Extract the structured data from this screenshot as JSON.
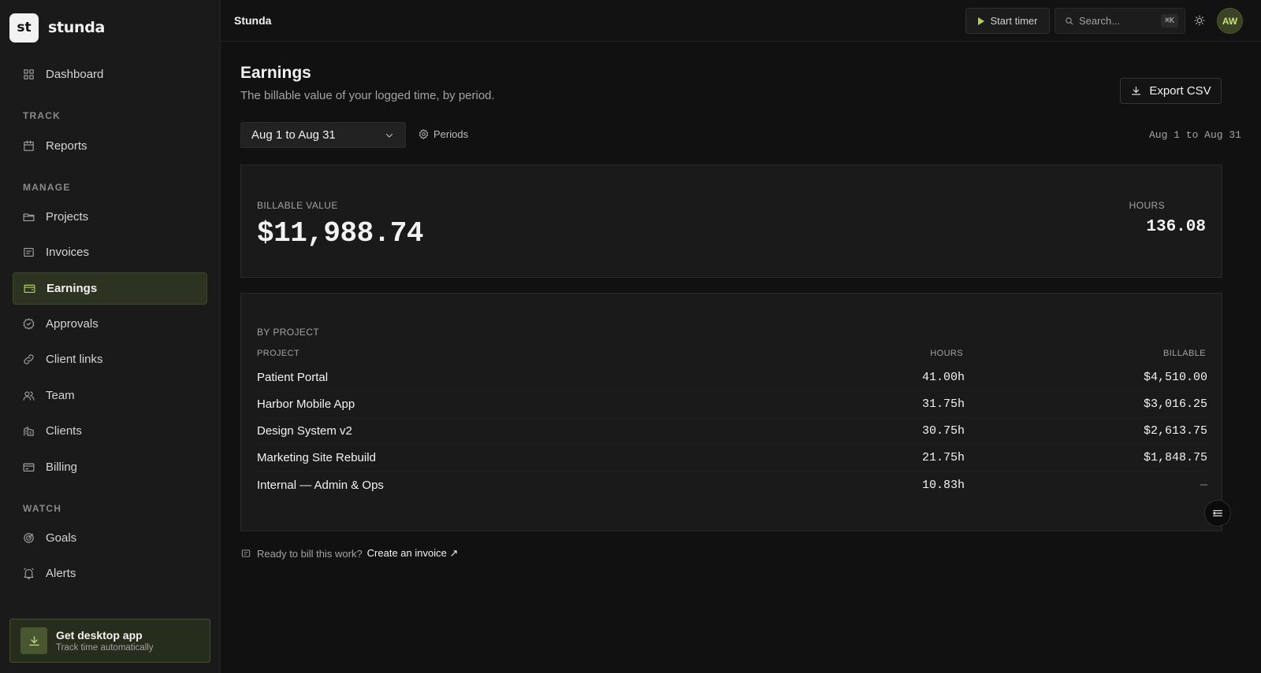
{
  "brand": {
    "logo_text": "st",
    "name": "stunda"
  },
  "sidebar": {
    "dashboard": "Dashboard",
    "sections": {
      "track": "TRACK",
      "manage": "MANAGE",
      "watch": "WATCH"
    },
    "items": {
      "reports": "Reports",
      "projects": "Projects",
      "invoices": "Invoices",
      "earnings": "Earnings",
      "approvals": "Approvals",
      "client_links": "Client links",
      "team": "Team",
      "clients": "Clients",
      "billing": "Billing",
      "goals": "Goals",
      "alerts": "Alerts"
    },
    "active": "earnings",
    "desktop_card": {
      "title": "Get desktop app",
      "subtitle": "Track time automatically"
    }
  },
  "topbar": {
    "crumb": "Stunda",
    "start_timer": "Start timer",
    "search_placeholder": "Search...",
    "search_shortcut": "⌘K",
    "avatar_initials": "AW"
  },
  "page": {
    "title": "Earnings",
    "subtitle": "The billable value of your logged time, by period.",
    "export_label": "Export CSV",
    "period_value": "Aug 1 to Aug 31",
    "periods_label": "Periods",
    "range_text": "Aug 1 to Aug 31"
  },
  "summary": {
    "billable_label": "BILLABLE VALUE",
    "billable_value": "$11,988.74",
    "hours_label": "HOURS",
    "hours_value": "136.08"
  },
  "by_project": {
    "section_label": "BY PROJECT",
    "columns": {
      "project": "PROJECT",
      "hours": "HOURS",
      "billable": "BILLABLE"
    },
    "rows": [
      {
        "project": "Patient Portal",
        "hours": "41.00h",
        "billable": "$4,510.00"
      },
      {
        "project": "Harbor Mobile App",
        "hours": "31.75h",
        "billable": "$3,016.25"
      },
      {
        "project": "Design System v2",
        "hours": "30.75h",
        "billable": "$2,613.75"
      },
      {
        "project": "Marketing Site Rebuild",
        "hours": "21.75h",
        "billable": "$1,848.75"
      },
      {
        "project": "Internal — Admin & Ops",
        "hours": "10.83h",
        "billable": "—"
      }
    ]
  },
  "footer_note": {
    "text": "Ready to bill this work?",
    "link": "Create an invoice ↗"
  },
  "colors": {
    "accent": "#b5d35a",
    "background": "#111111",
    "card": "#1a1a1a"
  }
}
